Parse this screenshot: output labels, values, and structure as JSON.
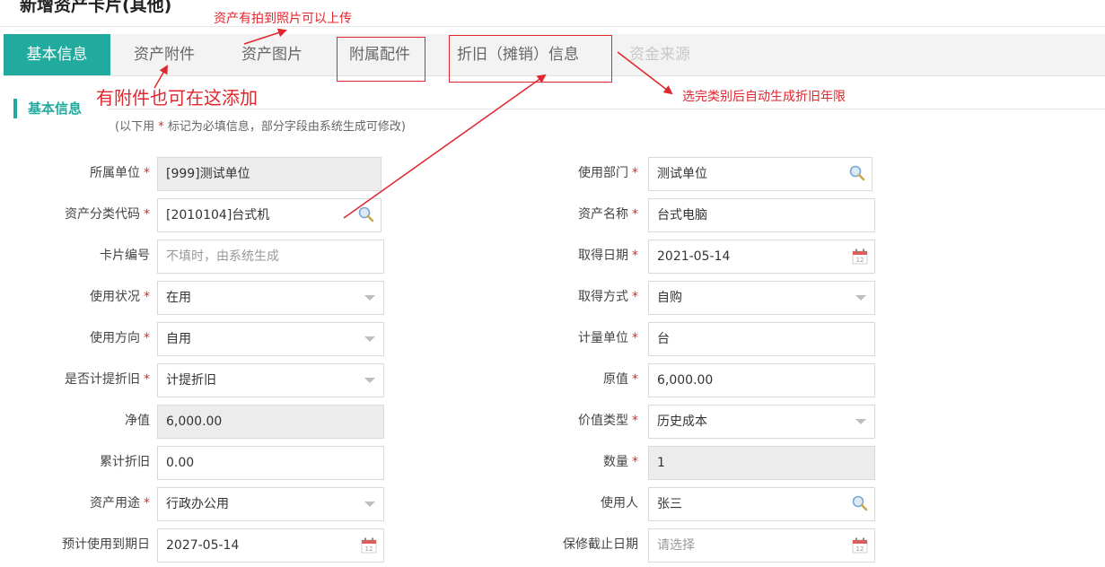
{
  "page": {
    "title": "新增资产卡片(其他)"
  },
  "tabs": [
    {
      "label": "基本信息",
      "state": "active"
    },
    {
      "label": "资产附件",
      "state": "normal"
    },
    {
      "label": "资产图片",
      "state": "normal"
    },
    {
      "label": "附属配件",
      "state": "normal"
    },
    {
      "label": "折旧（摊销）信息",
      "state": "normal"
    },
    {
      "label": "资金来源",
      "state": "disabled"
    }
  ],
  "section": {
    "title": "基本信息",
    "note_prefix": "(以下用",
    "note_star": "*",
    "note_suffix": "标记为必填信息，部分字段由系统生成可修改)"
  },
  "form": {
    "left": [
      {
        "label": "所属单位",
        "required": true,
        "value": "[999]测试单位",
        "type": "readonly"
      },
      {
        "label": "资产分类代码",
        "required": true,
        "value": "[2010104]台式机",
        "type": "lookup"
      },
      {
        "label": "卡片编号",
        "required": false,
        "placeholder": "不填时，由系统生成",
        "type": "text"
      },
      {
        "label": "使用状况",
        "required": true,
        "value": "在用",
        "type": "select"
      },
      {
        "label": "使用方向",
        "required": true,
        "value": "自用",
        "type": "select"
      },
      {
        "label": "是否计提折旧",
        "required": true,
        "value": "计提折旧",
        "type": "select"
      },
      {
        "label": "净值",
        "required": false,
        "value": "6,000.00",
        "type": "readonly"
      },
      {
        "label": "累计折旧",
        "required": false,
        "value": "0.00",
        "type": "text"
      },
      {
        "label": "资产用途",
        "required": true,
        "value": "行政办公用",
        "type": "select"
      },
      {
        "label": "预计使用到期日",
        "required": false,
        "value": "2027-05-14",
        "type": "date"
      }
    ],
    "right": [
      {
        "label": "使用部门",
        "required": true,
        "value": "测试单位",
        "type": "lookup"
      },
      {
        "label": "资产名称",
        "required": true,
        "value": "台式电脑",
        "type": "text"
      },
      {
        "label": "取得日期",
        "required": true,
        "value": "2021-05-14",
        "type": "date"
      },
      {
        "label": "取得方式",
        "required": true,
        "value": "自购",
        "type": "select"
      },
      {
        "label": "计量单位",
        "required": true,
        "value": "台",
        "type": "text"
      },
      {
        "label": "原值",
        "required": true,
        "value": "6,000.00",
        "type": "text"
      },
      {
        "label": "价值类型",
        "required": true,
        "value": "历史成本",
        "type": "select"
      },
      {
        "label": "数量",
        "required": true,
        "value": "1",
        "type": "readonly"
      },
      {
        "label": "使用人",
        "required": false,
        "value": "张三",
        "type": "lookup"
      },
      {
        "label": "保修截止日期",
        "required": false,
        "placeholder": "请选择",
        "type": "date"
      }
    ]
  },
  "annotations": {
    "photo_upload": "资产有拍到照片可以上传",
    "attachment_add": "有附件也可在这添加",
    "auto_depreciation": "选完类别后自动生成折旧年限"
  },
  "colors": {
    "accent": "#21ab9f",
    "annotation": "#e1262d",
    "required": "#e1262d"
  }
}
